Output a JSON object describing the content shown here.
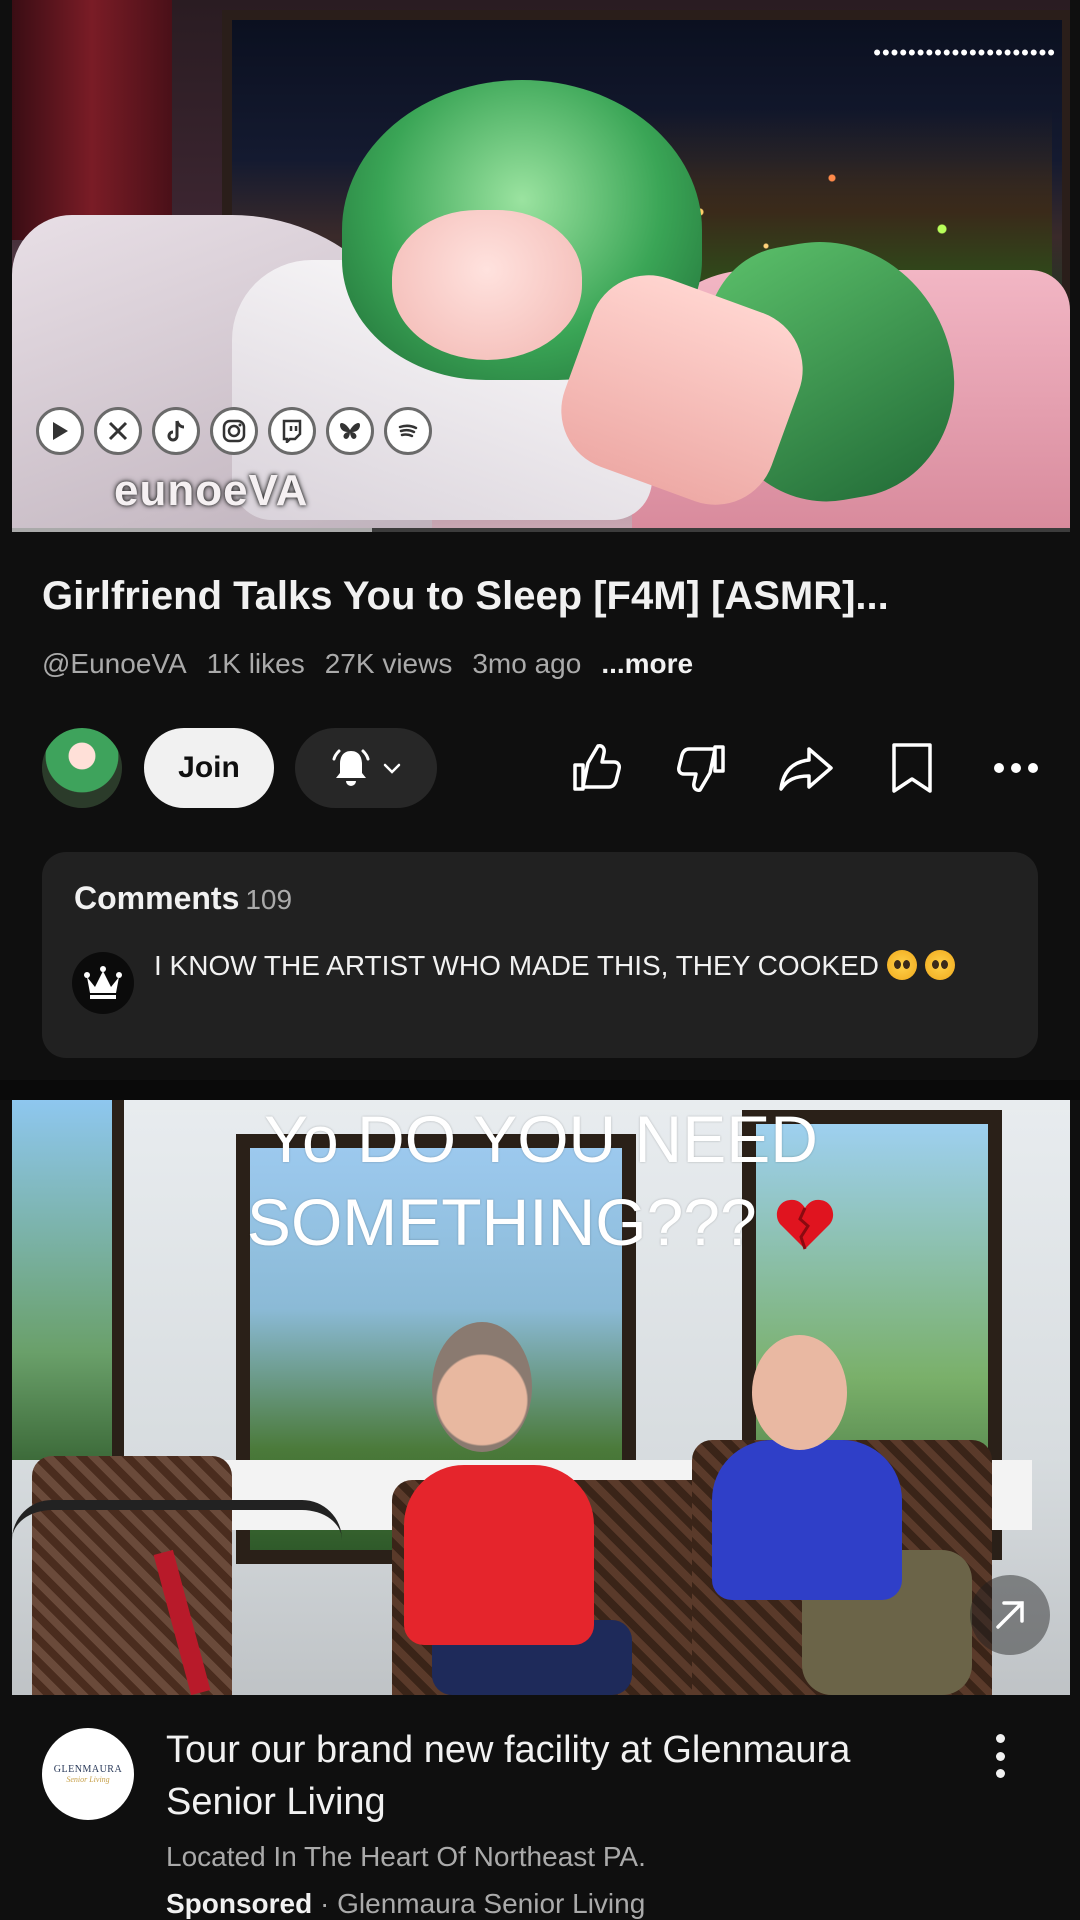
{
  "video": {
    "channel_brand": "eunoeVA",
    "socials": [
      "youtube-icon",
      "x-icon",
      "tiktok-icon",
      "instagram-icon",
      "twitch-icon",
      "bluesky-icon",
      "spotify-icon"
    ],
    "progress_fraction": 0.34,
    "title": "Girlfriend Talks You to Sleep [F4M] [ASMR]...",
    "channel_handle": "@EunoeVA",
    "likes": "1K likes",
    "views": "27K views",
    "age": "3mo ago",
    "more_label": "...more"
  },
  "actions": {
    "join_label": "Join",
    "icons": [
      "bell-icon",
      "like-icon",
      "dislike-icon",
      "share-icon",
      "save-icon",
      "more-icon"
    ]
  },
  "comments": {
    "heading": "Comments",
    "count": "109",
    "top_comment": "I KNOW THE ARTIST WHO MADE THIS, THEY COOKED"
  },
  "ad": {
    "caption_line1": "Yo DO YOU NEED",
    "caption_line2": "SOMETHING???",
    "logo_line1": "GLENMAURA",
    "logo_line2": "Senior Living",
    "title": "Tour our brand new facility at Glenmaura Senior Living",
    "subtitle": "Located In The Heart Of Northeast PA.",
    "sponsored_label": "Sponsored",
    "separator": "·",
    "advertiser": "Glenmaura Senior Living"
  },
  "colors": {
    "background": "#0f0f0f",
    "card": "#212121",
    "secondary_text": "#aaaaaa",
    "primary_text": "#f1f1f1"
  }
}
